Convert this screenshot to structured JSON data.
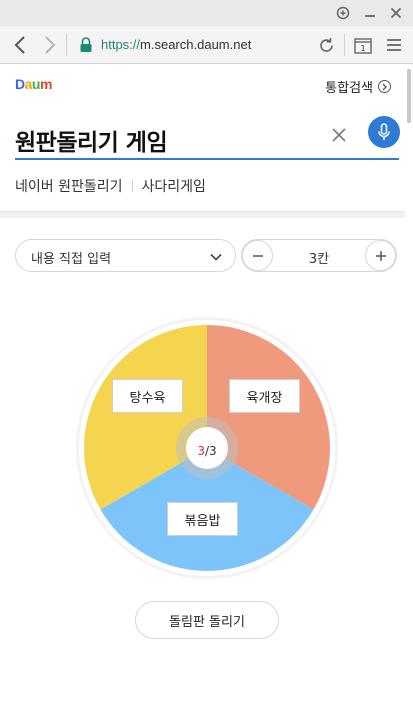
{
  "browser": {
    "url_scheme": "https://",
    "url_host": "m.search.daum.net",
    "tab_count": "1"
  },
  "header": {
    "logo": [
      "D",
      "a",
      "u",
      "m"
    ],
    "integrated_search_label": "통합검색"
  },
  "search": {
    "query": "원판돌리기 게임"
  },
  "related_searches": [
    "네이버 원판돌리기",
    "사다리게임"
  ],
  "controls": {
    "select_value": "내용 직접 입력",
    "stepper_value": "3칸"
  },
  "wheel": {
    "segments": [
      {
        "label": "육개장",
        "color": "#ef9a7c"
      },
      {
        "label": "볶음밥",
        "color": "#7cc4fa"
      },
      {
        "label": "탕수육",
        "color": "#f5d44f"
      }
    ],
    "hub_current": "3",
    "hub_separator": "/",
    "hub_total": "3"
  },
  "spin_button_label": "돌림판 돌리기",
  "colors": {
    "accent": "#2e7bd6",
    "url_green": "#1c8a6e"
  }
}
